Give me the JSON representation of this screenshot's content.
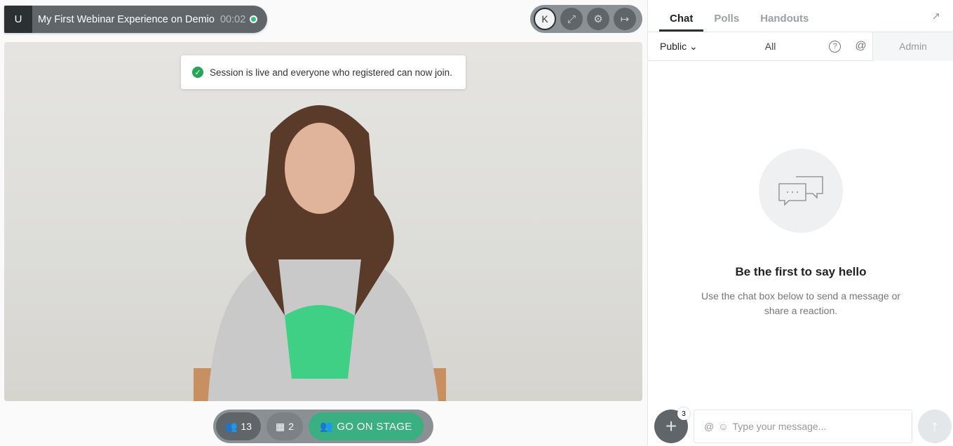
{
  "header": {
    "avatar_initial": "U",
    "title": "My First Webinar Experience on Demio",
    "timer": "00:02",
    "live_color": "#2ec27e"
  },
  "controls": {
    "user_initial": "K",
    "icons": [
      "expand-icon",
      "gear-icon",
      "exit-icon"
    ]
  },
  "toast": {
    "message": "Session is live and everyone who registered can now join."
  },
  "bottom": {
    "attendees_count": "13",
    "media_count": "2",
    "stage_label": "GO ON STAGE",
    "stage_color": "#3aaf82"
  },
  "panel": {
    "tabs": [
      {
        "label": "Chat",
        "active": true
      },
      {
        "label": "Polls"
      },
      {
        "label": "Handouts"
      }
    ],
    "filters": {
      "visibility": "Public",
      "all": "All",
      "admin": "Admin"
    },
    "empty": {
      "title": "Be the first to say hello",
      "text": "Use the chat box below to send a message or share a reaction."
    },
    "composer": {
      "badge": "3",
      "placeholder": "Type your message..."
    }
  }
}
